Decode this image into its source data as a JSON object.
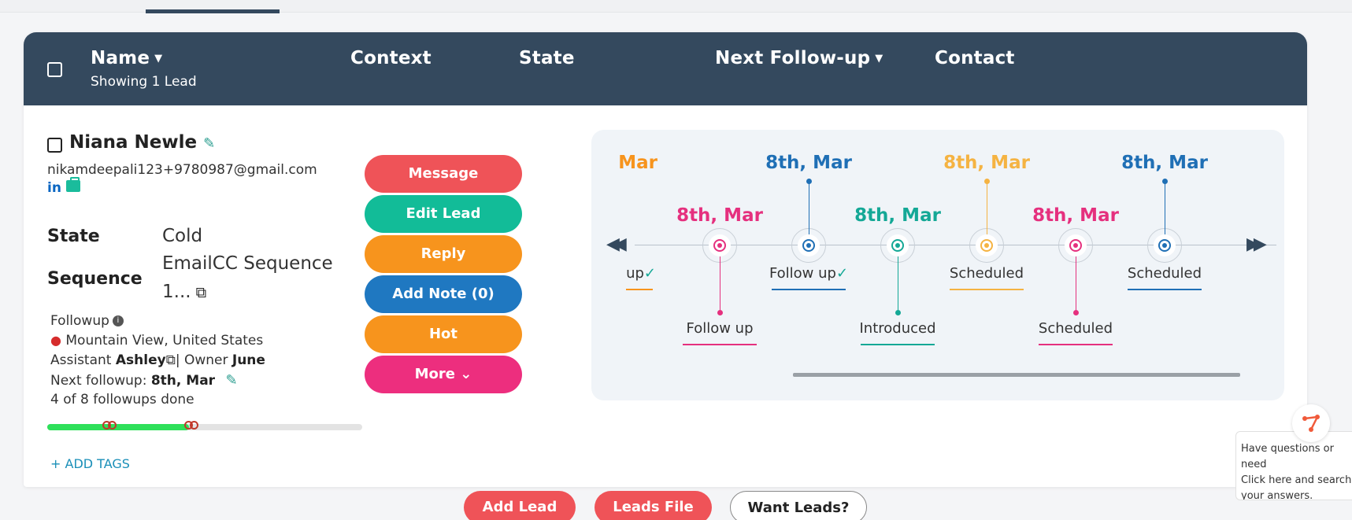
{
  "header": {
    "name_col": "Name",
    "showing": "Showing 1 Lead",
    "context_col": "Context",
    "state_col": "State",
    "followup_col": "Next Follow-up",
    "contact_col": "Contact"
  },
  "lead": {
    "name": "Niana Newle",
    "email": "nikamdeepali123+9780987@gmail.com",
    "linkedin": "in",
    "state_label": "State",
    "state_value": "Cold",
    "sequence_label": "Sequence",
    "sequence_line1": "EmailCC Sequence",
    "sequence_line2": "1...",
    "followup_title": "Followup",
    "location": "Mountain View, United States",
    "assistant_prefix": "Assistant",
    "assistant_name": "Ashley",
    "owner_prefix": "| Owner",
    "owner_name": "June",
    "next_followup_prefix": "Next followup:",
    "next_followup_date": "8th, Mar",
    "followups_done": "4 of 8 followups done",
    "progress_fraction": 0.5,
    "add_tags": "+ ADD TAGS"
  },
  "actions": [
    {
      "label": "Message",
      "color": "#ef5358"
    },
    {
      "label": "Edit Lead",
      "color": "#12bc98"
    },
    {
      "label": "Reply",
      "color": "#f7941d"
    },
    {
      "label": "Add Note (0)",
      "color": "#1f78c1"
    },
    {
      "label": "Hot",
      "color": "#f7941d"
    },
    {
      "label": "More",
      "color": "#ed2e7e"
    }
  ],
  "timeline": {
    "items": [
      {
        "date": "Mar",
        "label": "up",
        "color": "#f7941d",
        "checked": true,
        "position": "top"
      },
      {
        "date": "8th, Mar",
        "label": "Follow up",
        "color": "#e5307e",
        "checked": false,
        "position": "bottom"
      },
      {
        "date": "8th, Mar",
        "label": "Follow up",
        "color": "#1f6fb5",
        "checked": true,
        "position": "top"
      },
      {
        "date": "8th, Mar",
        "label": "Introduced",
        "color": "#14a896",
        "checked": false,
        "position": "bottom"
      },
      {
        "date": "8th, Mar",
        "label": "Scheduled",
        "color": "#f5b342",
        "checked": false,
        "position": "top"
      },
      {
        "date": "8th, Mar",
        "label": "Scheduled",
        "color": "#e5307e",
        "checked": false,
        "position": "bottom"
      },
      {
        "date": "8th, Mar",
        "label": "Scheduled",
        "color": "#1f6fb5",
        "checked": false,
        "position": "top"
      }
    ]
  },
  "bottom": {
    "add_lead": "Add Lead",
    "leads_file": "Leads File",
    "want_leads": "Want Leads?"
  },
  "help": {
    "line1": "Have questions or need",
    "line2": "Click here and search",
    "line3": "your answers."
  }
}
